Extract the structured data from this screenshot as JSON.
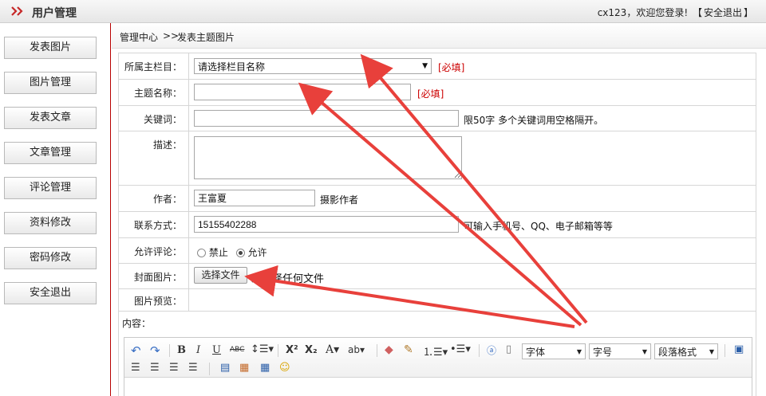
{
  "header": {
    "title": "用户管理",
    "welcome_user": "cx123",
    "welcome_text": "，欢迎您登录!",
    "logout_open": "【",
    "logout_label": "安全退出",
    "logout_close": "】"
  },
  "sidebar": {
    "items": [
      {
        "label": "发表图片"
      },
      {
        "label": "图片管理"
      },
      {
        "label": "发表文章"
      },
      {
        "label": "文章管理"
      },
      {
        "label": "评论管理"
      },
      {
        "label": "资料修改"
      },
      {
        "label": "密码修改"
      },
      {
        "label": "安全退出"
      }
    ]
  },
  "breadcrumb": {
    "home": "管理中心",
    "separator": ">>",
    "current": "发表主题图片"
  },
  "form": {
    "column": {
      "label": "所属主栏目：",
      "selected": "请选择栏目名称",
      "required": "[必填]"
    },
    "topic": {
      "label": "主题名称：",
      "value": "",
      "required": "[必填]"
    },
    "keywords": {
      "label": "关键词：",
      "value": "",
      "hint": "限50字 多个关键词用空格隔开。"
    },
    "description": {
      "label": "描述：",
      "value": ""
    },
    "author": {
      "label": "作者：",
      "value": "王富夏",
      "hint": "摄影作者"
    },
    "contact": {
      "label": "联系方式：",
      "value": "15155402288",
      "hint": "可输入手机号、QQ、电子邮箱等等"
    },
    "comments": {
      "label": "允许评论：",
      "options": [
        "禁止",
        "允许"
      ],
      "selected": "允许"
    },
    "cover": {
      "label": "封面图片：",
      "button": "选择文件",
      "status": "未选择任何文件"
    },
    "preview": {
      "label": "图片预览："
    },
    "content": {
      "label": "内容："
    }
  },
  "editor": {
    "font_family": "字体",
    "font_size": "字号",
    "paragraph": "段落格式",
    "buttons": [
      "undo",
      "redo",
      "bold",
      "italic",
      "underline",
      "strikethrough",
      "line-height",
      "superscript",
      "subscript",
      "font-color",
      "highlight",
      "eraser",
      "format-painter",
      "ordered-list",
      "unordered-list",
      "anchor",
      "new-page",
      "justify-left",
      "justify-center",
      "justify-right",
      "justify-full",
      "insert-code",
      "insert-image",
      "insert-table",
      "emotion",
      "preview"
    ]
  },
  "colors": {
    "accent": "#b80000",
    "required": "#cc0000",
    "arrow": "#e8403b"
  }
}
